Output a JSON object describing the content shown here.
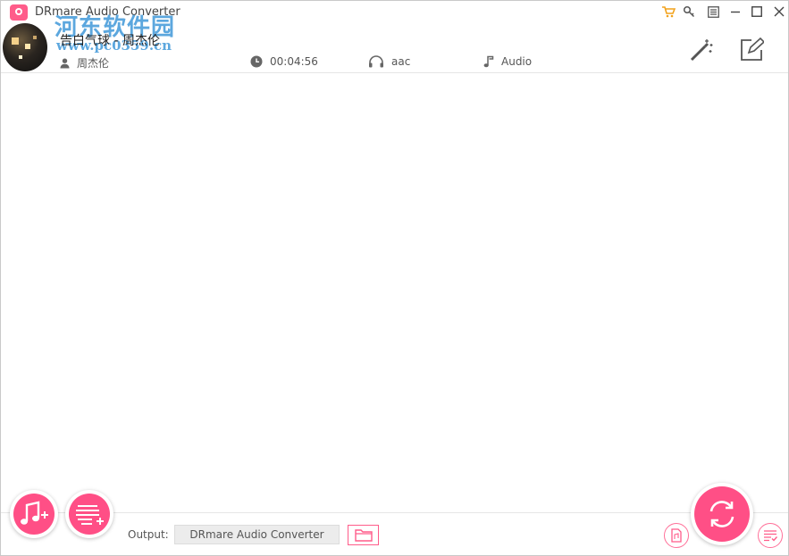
{
  "app": {
    "title": "DRmare Audio Converter",
    "accent_color": "#ff4f86"
  },
  "watermark": {
    "text": "河东软件园",
    "url": "www.pc0359.cn"
  },
  "titlebar": {
    "icons": [
      "cart-icon",
      "key-icon",
      "menu-icon",
      "minimize-icon",
      "maximize-icon",
      "close-icon"
    ]
  },
  "track": {
    "title": "告白气球 - 周杰伦",
    "artist": "周杰伦",
    "duration": "00:04:56",
    "format": "aac",
    "type": "Audio"
  },
  "header_actions": [
    "magic-wand-icon",
    "edit-icon"
  ],
  "bottom": {
    "output_label": "Output:",
    "output_value": "DRmare Audio Converter",
    "buttons": [
      "add-music-button",
      "add-playlist-button",
      "open-folder-button",
      "audio-file-button",
      "convert-button",
      "converted-list-button"
    ]
  }
}
